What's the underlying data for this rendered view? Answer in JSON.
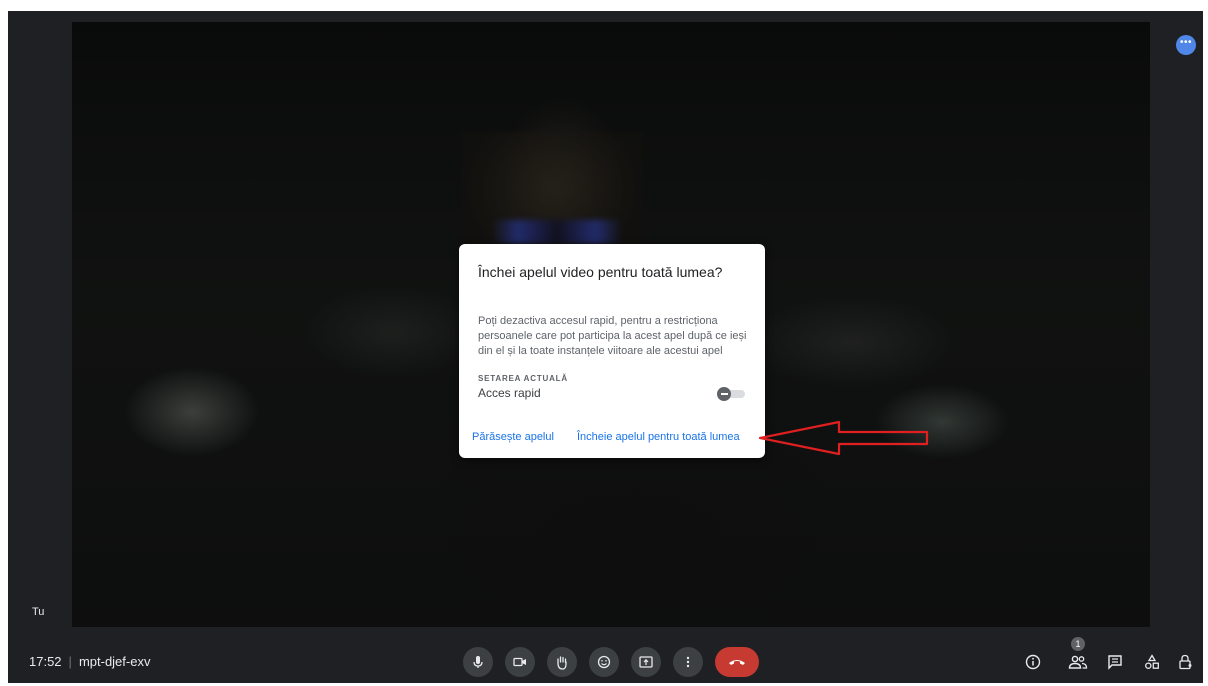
{
  "video": {
    "self_label": "Tu"
  },
  "top_right": {
    "more_label": "•••"
  },
  "bottom_bar": {
    "time": "17:52",
    "meeting_code": "mpt-djef-exv",
    "separator": "|",
    "controls": [
      {
        "name": "microphone",
        "icon": "mic-icon"
      },
      {
        "name": "camera",
        "icon": "video-icon"
      },
      {
        "name": "raise-hand",
        "icon": "hand-icon"
      },
      {
        "name": "reactions",
        "icon": "emoji-icon"
      },
      {
        "name": "present-screen",
        "icon": "present-icon"
      },
      {
        "name": "more-options",
        "icon": "more-vert-icon"
      },
      {
        "name": "leave-call",
        "icon": "call-end-icon",
        "color": "#c63a32"
      }
    ],
    "right_icons": [
      {
        "name": "meeting-details",
        "icon": "info-icon"
      },
      {
        "name": "people",
        "icon": "people-icon",
        "badge": "1"
      },
      {
        "name": "chat",
        "icon": "chat-icon"
      },
      {
        "name": "activities",
        "icon": "shapes-icon"
      },
      {
        "name": "host-controls",
        "icon": "lock-person-icon"
      }
    ]
  },
  "dialog": {
    "title": "Închei apelul video pentru toată lumea?",
    "body": "Poți dezactiva accesul rapid, pentru a restricționa persoanele care pot participa la acest apel după ce ieși din el și la toate instanțele viitoare ale acestui apel",
    "setting_label": "SETAREA ACTUALĂ",
    "setting_value": "Acces rapid",
    "toggle_state": "off",
    "leave_label": "Părăsește apelul",
    "end_all_label": "Încheie apelul pentru toată lumea"
  },
  "annotation": {
    "arrow_color": "#e02020"
  },
  "colors": {
    "accent": "#1a73e8",
    "end_call": "#c63a32",
    "background": "#1f2023"
  }
}
